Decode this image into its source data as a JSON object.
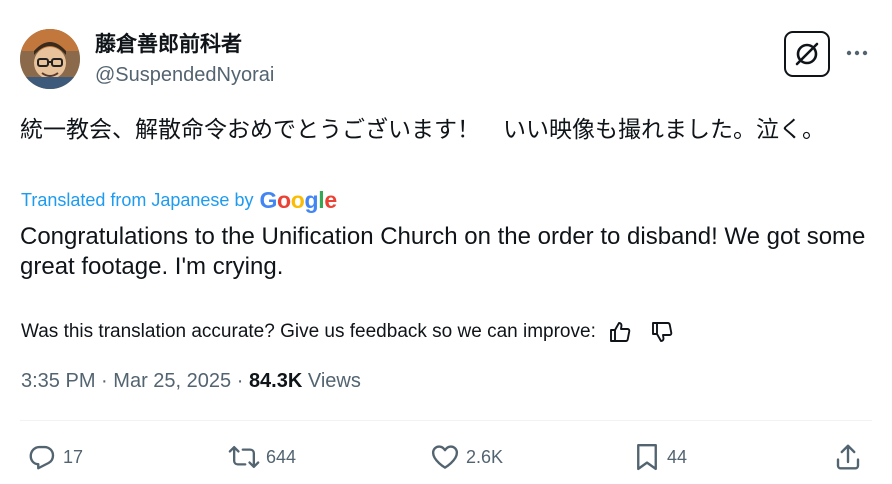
{
  "author": {
    "display_name": "藤倉善郎前科者",
    "handle": "@SuspendedNyorai"
  },
  "tweet": {
    "text": "統一教会、解散命令おめでとうございます！　いい映像も撮れました。泣く。",
    "translated_label": "Translated from Japanese by",
    "translation_provider": "Google",
    "translation": "Congratulations to the Unification Church on the order to disband! We got some great footage. I'm crying."
  },
  "feedback": {
    "question": "Was this translation accurate? Give us feedback so we can improve:"
  },
  "meta": {
    "time": "3:35 PM",
    "separator": "·",
    "date": "Mar 25, 2025",
    "views_count": "84.3K",
    "views_label": "Views"
  },
  "actions": {
    "replies": "17",
    "reposts": "644",
    "likes": "2.6K",
    "bookmarks": "44"
  },
  "icons": {
    "grok": "grok-icon",
    "more": "more-icon",
    "thumbs_up": "thumbs-up-icon",
    "thumbs_down": "thumbs-down-icon",
    "reply": "reply-icon",
    "repost": "repost-icon",
    "like": "heart-icon",
    "bookmark": "bookmark-icon",
    "share": "share-icon"
  },
  "colors": {
    "text": "#0f1419",
    "secondary": "#536471",
    "link": "#1d9bf0",
    "google_blue": "#4285F4",
    "google_red": "#EA4335",
    "google_yellow": "#FBBC05",
    "google_green": "#34A853"
  }
}
